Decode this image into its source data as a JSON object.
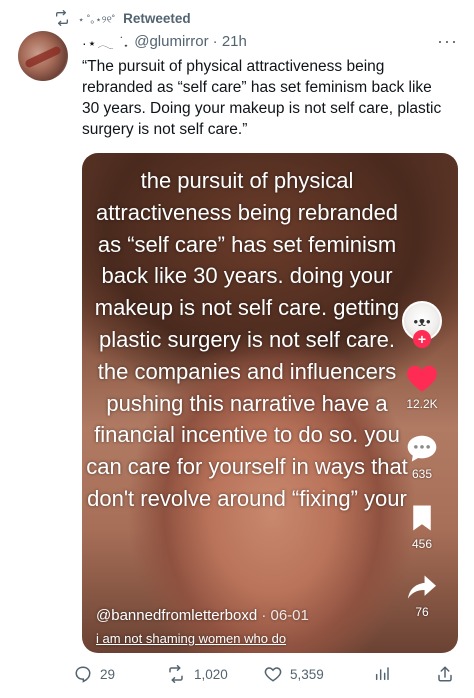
{
  "retweet": {
    "decoration": "⋆ ˚｡⋆୨୧˚",
    "label": "Retweeted"
  },
  "author": {
    "display_name": "·⋆𓂃 ࣪ ˖",
    "handle": "@glumirror",
    "time": "21h",
    "more": "···"
  },
  "tweet": {
    "text": "“The pursuit of physical attractiveness being rebranded as “self care” has set feminism back like 30 years. Doing your makeup is not self care, plastic surgery is not self care.”"
  },
  "media": {
    "overlay_text": "the pursuit of physical attractiveness being rebranded as “self care” has set feminism back like 30 years. doing your makeup is not self care. getting plastic surgery is not self care. the companies and influencers pushing this narrative have a financial incentive to do so. you can care for yourself in ways that don't revolve around “fixing” your",
    "creator_username": "@bannedfromletterboxd",
    "creator_date": " · 06-01",
    "caption": "i am not shaming women who do",
    "likes": "12.2K",
    "comments": "635",
    "saves": "456",
    "shares": "76",
    "follow_symbol": "+"
  },
  "actions": {
    "replies": "29",
    "retweets": "1,020",
    "likes": "5,359"
  },
  "colors": {
    "like_red": "#fe2c55",
    "secondary_text": "#536471"
  }
}
